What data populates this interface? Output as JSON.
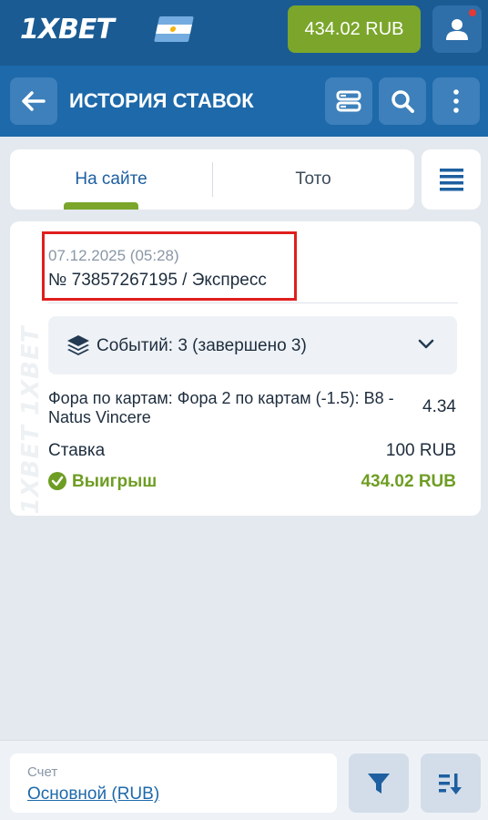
{
  "header": {
    "logo": "1XBET",
    "balance": "434.02 RUB"
  },
  "titlebar": {
    "title": "ИСТОРИЯ СТАВОК"
  },
  "tabs": [
    {
      "label": "На сайте",
      "active": true
    },
    {
      "label": "Тото",
      "active": false
    }
  ],
  "bet": {
    "date": "07.12.2025 (05:28)",
    "number": "№ 73857267195 / Экспресс",
    "events_summary": "Событий: 3 (завершено 3)",
    "market": "Фора по картам: Фора 2 по картам (-1.5): B8 - Natus Vincere",
    "odds": "4.34",
    "stake_label": "Ставка",
    "stake_value": "100 RUB",
    "win_label": "Выигрыш",
    "win_value": "434.02 RUB",
    "watermark": "1XBET 1XBET 1XBET"
  },
  "footer": {
    "account_label": "Счет",
    "account_value": "Основной (RUB)"
  },
  "colors": {
    "header": "#1a5b94",
    "titlebar": "#1d69aa",
    "accent_green": "#7ba62b",
    "win_green": "#6e9d23",
    "highlight_red": "#e01e1e"
  }
}
